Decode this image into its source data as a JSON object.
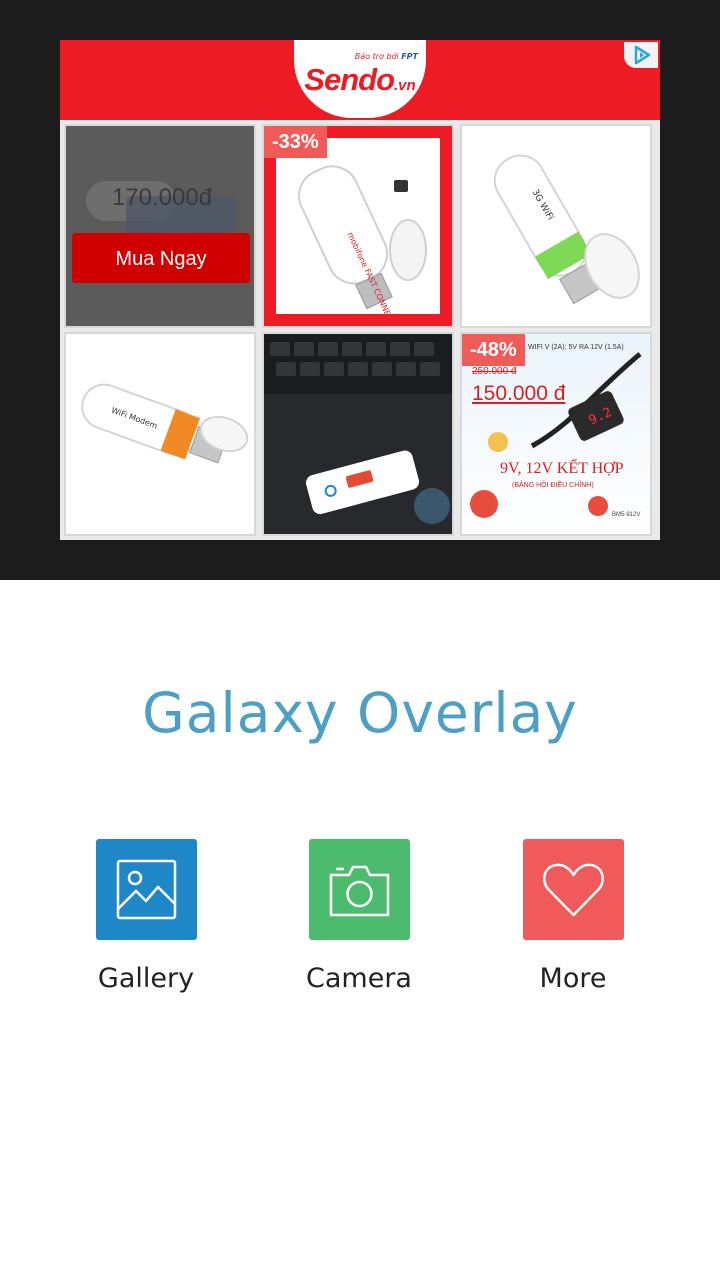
{
  "ad": {
    "brand": "Sendo",
    "brand_tld": ".vn",
    "sponsor_prefix": "Bảo trợ bởi",
    "sponsor_name": "FPT",
    "products": [
      {
        "price": "170.000đ",
        "cta": "Mua Ngay"
      },
      {
        "discount": "-33%"
      },
      {},
      {},
      {},
      {
        "discount": "-48%",
        "old_price": "250.000 đ",
        "price": "150.000 đ",
        "headline": "9V, 12V KẾT HỢP",
        "top_text": "WIFI  V (2A); 5V RA 12V (1.5A)",
        "sub_text": "(BẢNG HỘI ĐIỀU CHỈNH)",
        "model": "BM5-912V"
      }
    ]
  },
  "app": {
    "title": "Galaxy Overlay",
    "actions": [
      {
        "label": "Gallery",
        "icon": "gallery-icon",
        "color": "#1e87c8"
      },
      {
        "label": "Camera",
        "icon": "camera-icon",
        "color": "#4dbb6d"
      },
      {
        "label": "More",
        "icon": "heart-icon",
        "color": "#f05a5a"
      }
    ]
  }
}
